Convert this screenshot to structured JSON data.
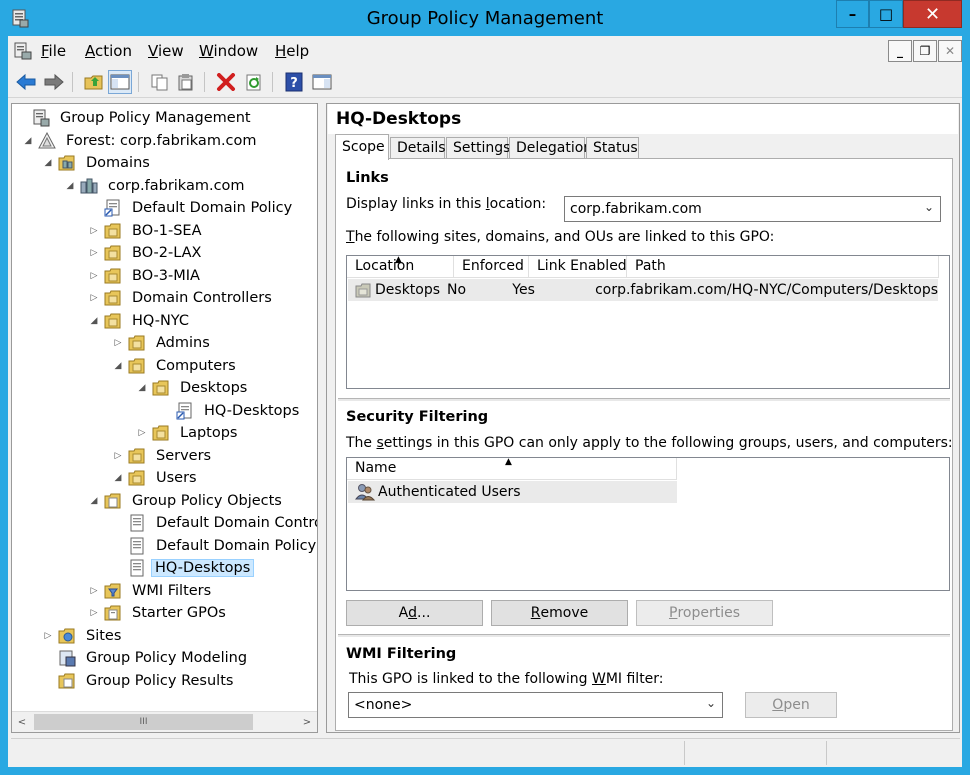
{
  "window": {
    "title": "Group Policy Management",
    "minimize": "–",
    "maximize": "□",
    "close": "✕"
  },
  "menu": {
    "items": [
      {
        "label": "File",
        "key": "F",
        "rest": "ile"
      },
      {
        "label": "Action",
        "key": "A",
        "rest": "ction"
      },
      {
        "label": "View",
        "key": "V",
        "rest": "iew"
      },
      {
        "label": "Window",
        "key": "W",
        "rest": "indow"
      },
      {
        "label": "Help",
        "key": "H",
        "rest": "elp"
      }
    ],
    "mdi_min": "_",
    "mdi_restore": "❐",
    "mdi_close": "✕"
  },
  "toolbar": {
    "icons": [
      "back-arrow-icon",
      "forward-arrow-icon",
      "up-folder-icon",
      "show-hide-console-tree-icon",
      "copy-icon",
      "paste-icon",
      "delete-icon",
      "refresh-icon",
      "help-icon",
      "properties-pane-icon"
    ]
  },
  "tree": {
    "items": [
      {
        "label": "Group Policy Management",
        "exp": "",
        "icon": "gpm-console-icon"
      },
      {
        "label": "Forest: corp.fabrikam.com",
        "exp": "◢",
        "icon": "forest-icon"
      },
      {
        "label": "Domains",
        "exp": "◢",
        "icon": "domains-folder-icon"
      },
      {
        "label": "corp.fabrikam.com",
        "exp": "◢",
        "icon": "domain-icon"
      },
      {
        "label": "Default Domain Policy",
        "exp": "",
        "icon": "gpo-link-icon"
      },
      {
        "label": "BO-1-SEA",
        "exp": "▷",
        "icon": "ou-folder-icon"
      },
      {
        "label": "BO-2-LAX",
        "exp": "▷",
        "icon": "ou-folder-icon"
      },
      {
        "label": "BO-3-MIA",
        "exp": "▷",
        "icon": "ou-folder-icon"
      },
      {
        "label": "Domain Controllers",
        "exp": "▷",
        "icon": "ou-folder-icon"
      },
      {
        "label": "HQ-NYC",
        "exp": "◢",
        "icon": "ou-folder-icon"
      },
      {
        "label": "Admins",
        "exp": "▷",
        "icon": "ou-folder-icon"
      },
      {
        "label": "Computers",
        "exp": "◢",
        "icon": "ou-folder-icon"
      },
      {
        "label": "Desktops",
        "exp": "◢",
        "icon": "ou-folder-icon"
      },
      {
        "label": "HQ-Desktops",
        "exp": "",
        "icon": "gpo-link-icon"
      },
      {
        "label": "Laptops",
        "exp": "▷",
        "icon": "ou-folder-icon"
      },
      {
        "label": "Servers",
        "exp": "▷",
        "icon": "ou-folder-icon"
      },
      {
        "label": "Users",
        "exp": "◢",
        "icon": "ou-folder-icon"
      },
      {
        "label": "Group Policy Objects",
        "exp": "◢",
        "icon": "gpo-container-icon"
      },
      {
        "label": "Default Domain Contro",
        "exp": "",
        "icon": "gpo-icon"
      },
      {
        "label": "Default Domain Policy",
        "exp": "",
        "icon": "gpo-icon"
      },
      {
        "label": "HQ-Desktops",
        "exp": "",
        "icon": "gpo-icon",
        "selected": true
      },
      {
        "label": "WMI Filters",
        "exp": "▷",
        "icon": "wmi-filters-icon"
      },
      {
        "label": "Starter GPOs",
        "exp": "▷",
        "icon": "starter-gpos-icon"
      },
      {
        "label": "Sites",
        "exp": "▷",
        "icon": "sites-icon"
      },
      {
        "label": "Group Policy Modeling",
        "exp": "",
        "icon": "gp-modeling-icon"
      },
      {
        "label": "Group Policy Results",
        "exp": "",
        "icon": "gp-results-icon"
      }
    ],
    "scroll_thumb": "III",
    "scroll_left": "<",
    "scroll_right": ">"
  },
  "detail": {
    "title": "HQ-Desktops",
    "tabs": [
      "Scope",
      "Details",
      "Settings",
      "Delegation",
      "Status"
    ],
    "links": {
      "heading": "Links",
      "display_label_pre": "Display links in this ",
      "display_label_key": "l",
      "display_label_post": "ocation:",
      "location_value": "corp.fabrikam.com",
      "linked_text_key": "T",
      "linked_text_rest": "he following sites, domains, and OUs are linked to this GPO:",
      "columns": [
        "Location",
        "Enforced",
        "Link Enabled",
        "Path"
      ],
      "rows": [
        {
          "location": "Desktops",
          "enforced": "No",
          "link_enabled": "Yes",
          "path": "corp.fabrikam.com/HQ-NYC/Computers/Desktops"
        }
      ]
    },
    "security": {
      "heading": "Security Filtering",
      "text_pre": "The ",
      "text_key": "s",
      "text_post": "ettings in this GPO can only apply to the following groups, users, and computers:",
      "columns": [
        "Name"
      ],
      "rows": [
        {
          "name": "Authenticated Users"
        }
      ],
      "add_key": "d",
      "add_pre": "A",
      "add_post": "d...",
      "remove_key": "R",
      "remove_rest": "emove",
      "properties_key": "P",
      "properties_rest": "roperties"
    },
    "wmi": {
      "heading": "WMI Filtering",
      "text_pre": "This GPO is linked to the following ",
      "text_key": "W",
      "text_post": "MI filter:",
      "value": "<none>",
      "open_key": "O",
      "open_rest": "pen"
    }
  }
}
